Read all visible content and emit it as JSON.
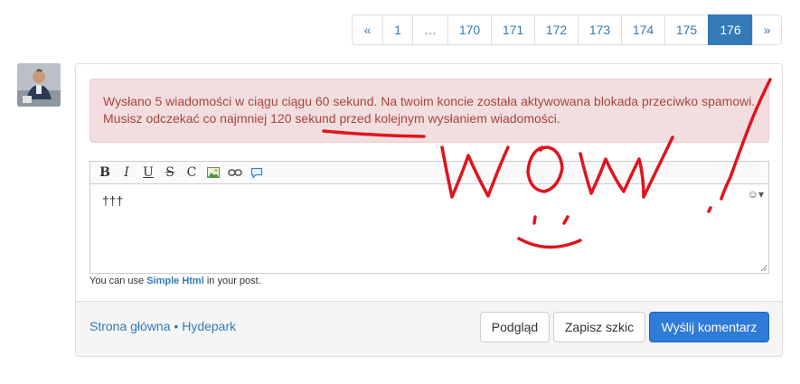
{
  "pagination": {
    "prev": "«",
    "pages": [
      "1",
      "…",
      "170",
      "171",
      "172",
      "173",
      "174",
      "175",
      "176"
    ],
    "active": "176",
    "next": "»"
  },
  "alert": {
    "message": "Wysłano 5 wiadomości w ciągu ciągu 60 sekund. Na twoim koncie została aktywowana blokada przeciwko spamowi. Musisz odczekać co najmniej 120 sekund przed kolejnym wysłaniem wiadomości."
  },
  "editor": {
    "toolbar": {
      "bold": "B",
      "italic": "I",
      "underline": "U",
      "strike": "S",
      "code": "C"
    },
    "content": "†††",
    "smiley": "☺▾"
  },
  "help": {
    "prefix": "You can use ",
    "link": "Simple Html",
    "suffix": " in your post."
  },
  "footer": {
    "breadcrumb_home": "Strona główna",
    "breadcrumb_sep": "•",
    "breadcrumb_forum": "Hydepark",
    "preview_button": "Podgląd",
    "draft_button": "Zapisz szkic",
    "submit_button": "Wyślij komentarz"
  },
  "colors": {
    "link": "#337ab7",
    "alert_bg": "#f2dede",
    "alert_text": "#a94442",
    "primary": "#2f7bd8",
    "scribble": "#e0141e"
  }
}
